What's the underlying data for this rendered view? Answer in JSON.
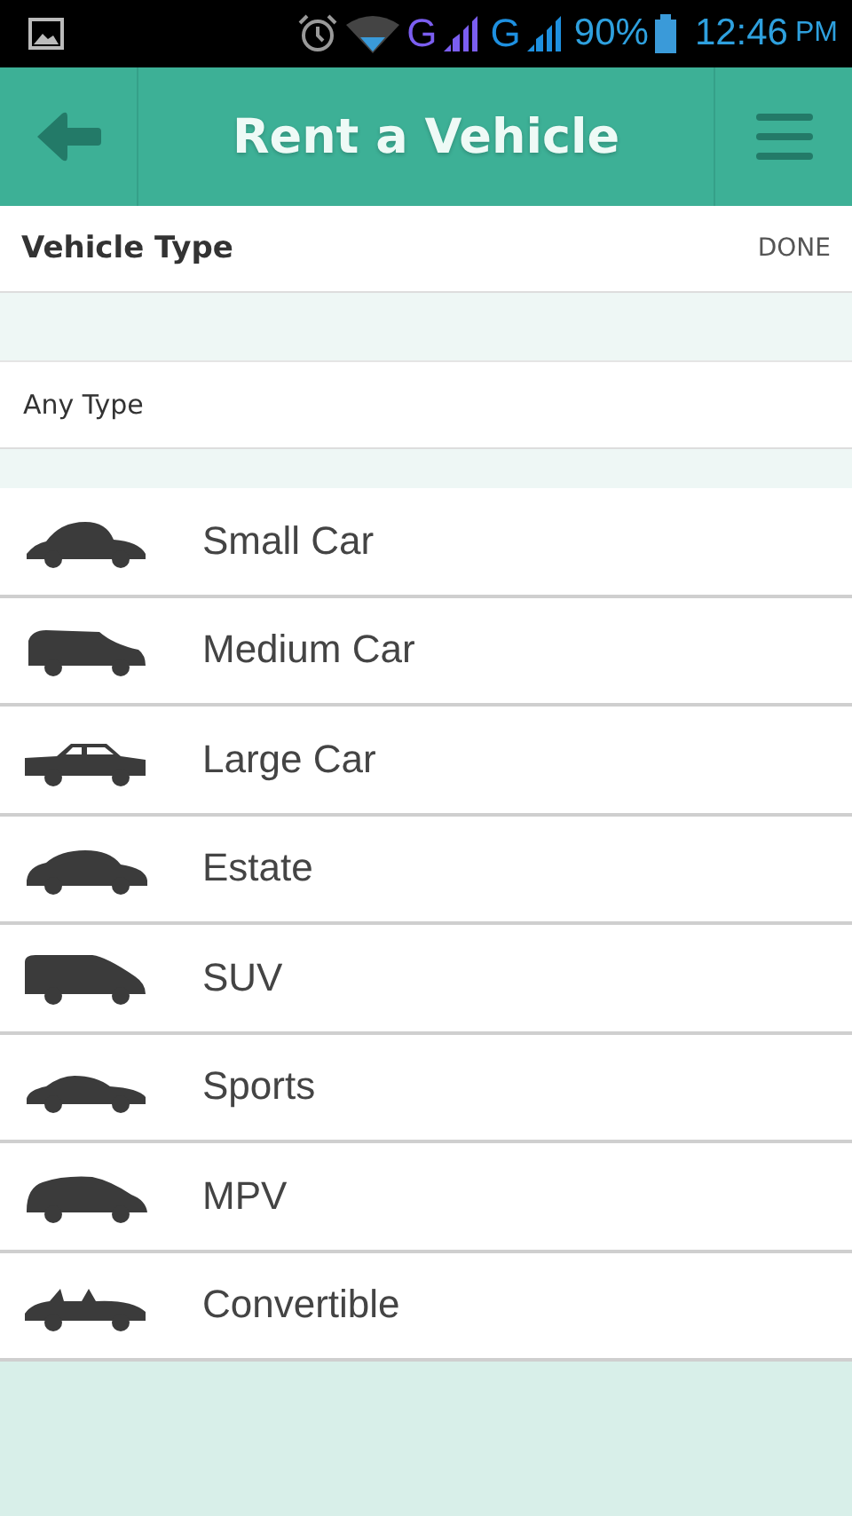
{
  "status_bar": {
    "network_1": "G",
    "network_2": "G",
    "battery": "90%",
    "time": "12:46",
    "meridiem": "PM"
  },
  "header": {
    "title": "Rent a Vehicle"
  },
  "section": {
    "title": "Vehicle Type",
    "action": "DONE"
  },
  "any_type": {
    "label": "Any Type"
  },
  "vehicles": [
    {
      "label": "Small Car",
      "kind": "beetle"
    },
    {
      "label": "Medium Car",
      "kind": "hatch"
    },
    {
      "label": "Large Car",
      "kind": "sedan"
    },
    {
      "label": "Estate",
      "kind": "estate"
    },
    {
      "label": "SUV",
      "kind": "suv"
    },
    {
      "label": "Sports",
      "kind": "sports"
    },
    {
      "label": "MPV",
      "kind": "mpv"
    },
    {
      "label": "Convertible",
      "kind": "convertible"
    }
  ]
}
